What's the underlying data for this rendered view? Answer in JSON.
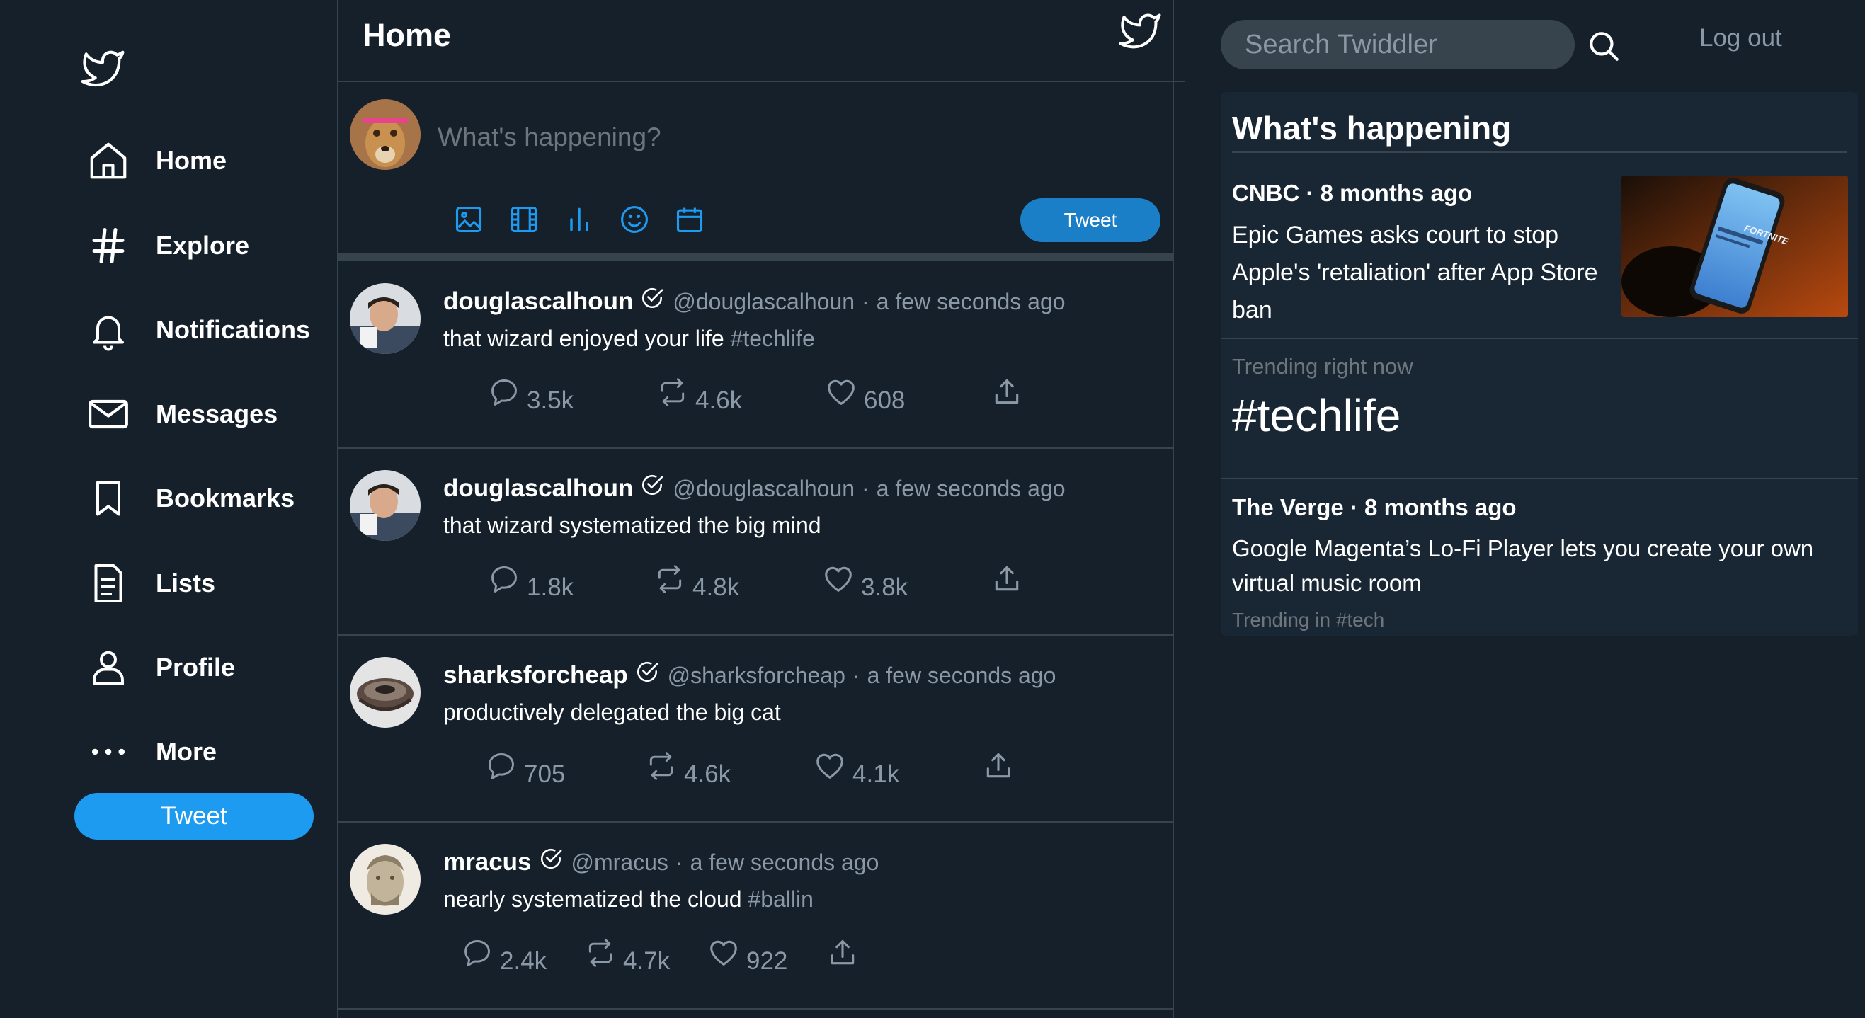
{
  "sidebar": {
    "items": [
      {
        "label": "Home",
        "icon": "home-icon"
      },
      {
        "label": "Explore",
        "icon": "hashtag-icon"
      },
      {
        "label": "Notifications",
        "icon": "bell-icon"
      },
      {
        "label": "Messages",
        "icon": "envelope-icon"
      },
      {
        "label": "Bookmarks",
        "icon": "bookmark-icon"
      },
      {
        "label": "Lists",
        "icon": "list-document-icon"
      },
      {
        "label": "Profile",
        "icon": "person-icon"
      },
      {
        "label": "More",
        "icon": "more-dots-icon"
      }
    ],
    "tweet_button": "Tweet"
  },
  "header": {
    "title": "Home"
  },
  "composer": {
    "placeholder": "What's happening?",
    "tools": [
      "image-icon",
      "gif-film-icon",
      "poll-icon",
      "emoji-icon",
      "schedule-calendar-icon"
    ],
    "tweet_button": "Tweet"
  },
  "tweets": [
    {
      "name": "douglascalhoun",
      "handle": "@douglascalhoun",
      "time": "a few seconds ago",
      "text": "that wizard enjoyed your life ",
      "tag": "#techlife",
      "replies": "3.5k",
      "retweets": "4.6k",
      "likes": "608"
    },
    {
      "name": "douglascalhoun",
      "handle": "@douglascalhoun",
      "time": "a few seconds ago",
      "text": "that wizard systematized the big mind",
      "tag": "",
      "replies": "1.8k",
      "retweets": "4.8k",
      "likes": "3.8k"
    },
    {
      "name": "sharksforcheap",
      "handle": "@sharksforcheap",
      "time": "a few seconds ago",
      "text": "productively delegated the big cat",
      "tag": "",
      "replies": "705",
      "retweets": "4.6k",
      "likes": "4.1k"
    },
    {
      "name": "mracus",
      "handle": "@mracus",
      "time": "a few seconds ago",
      "text": "nearly systematized the cloud ",
      "tag": "#ballin",
      "replies": "2.4k",
      "retweets": "4.7k",
      "likes": "922"
    }
  ],
  "search": {
    "placeholder": "Search Twiddler"
  },
  "logout": "Log out",
  "trends": {
    "title": "What's happening",
    "news": [
      {
        "source": "CNBC · 8 months ago",
        "title": "Epic Games asks court to stop Apple's 'retaliation' after App Store ban"
      },
      {
        "source": "The Verge · 8 months ago",
        "title": "Google Magenta’s Lo-Fi Player lets you create your own virtual music room",
        "footer": "Trending in #tech"
      }
    ],
    "trending_label": "Trending right now",
    "trending_tag": "#techlife"
  },
  "colors": {
    "background": "#15202b",
    "panel": "#192734",
    "accent": "#1d9bf0",
    "icon_blue": "#1d9bf0",
    "muted_text": "#8b98a5",
    "border": "#38444d"
  },
  "thumbnail_text": "FORTNITE"
}
